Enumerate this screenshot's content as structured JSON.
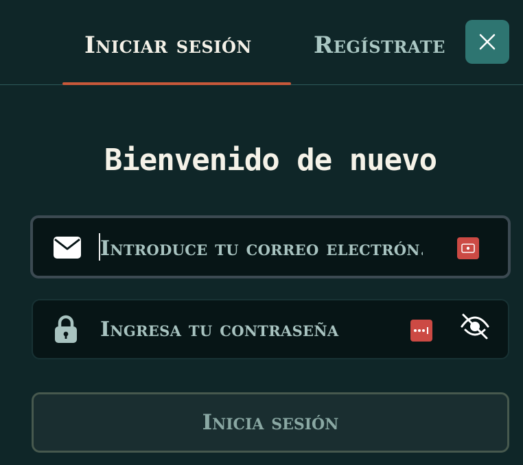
{
  "tabs": {
    "login_label": "Iniciar sesión",
    "register_label": "Regístrate",
    "active": "login"
  },
  "close": {
    "icon": "close-icon"
  },
  "form": {
    "heading": "Bienvenido de nuevo",
    "email": {
      "placeholder": "Introduce tu correo electrón...",
      "icon": "envelope-icon",
      "value": ""
    },
    "password": {
      "placeholder": "Ingresa tu contraseña",
      "icon": "lock-icon",
      "visibility_icon": "eye-off-icon",
      "value": ""
    },
    "submit_label": "Inicia sesión"
  },
  "colors": {
    "background": "#0f2628",
    "accent": "#c8583a",
    "close_button": "#2e7571",
    "password_manager_badge": "#cc4a44",
    "muted_text": "#a8c3c0"
  }
}
